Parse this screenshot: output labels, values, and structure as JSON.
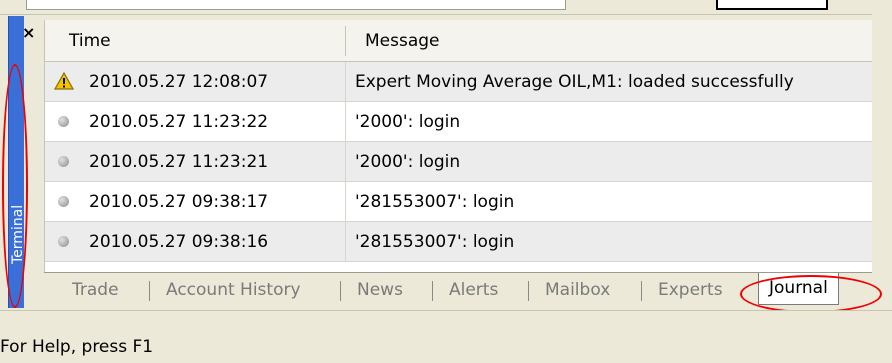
{
  "terminal": {
    "side_label": "Terminal",
    "close_symbol": "×"
  },
  "grid": {
    "columns": [
      "Time",
      "Message"
    ],
    "rows": [
      {
        "icon": "warning-icon",
        "time": "2010.05.27 12:08:07",
        "message": "Expert Moving Average OIL,M1: loaded successfully"
      },
      {
        "icon": "info-dot-icon",
        "time": "2010.05.27 11:23:22",
        "message": "'2000': login"
      },
      {
        "icon": "info-dot-icon",
        "time": "2010.05.27 11:23:21",
        "message": "'2000': login"
      },
      {
        "icon": "info-dot-icon",
        "time": "2010.05.27 09:38:17",
        "message": "'281553007': login"
      },
      {
        "icon": "info-dot-icon",
        "time": "2010.05.27 09:38:16",
        "message": "'281553007': login"
      }
    ]
  },
  "tabs": [
    {
      "label": "Trade"
    },
    {
      "label": "Account History"
    },
    {
      "label": "News"
    },
    {
      "label": "Alerts"
    },
    {
      "label": "Mailbox"
    },
    {
      "label": "Experts"
    },
    {
      "label": "Journal",
      "active": true
    }
  ],
  "status_bar": {
    "text": "For Help, press F1"
  },
  "colors": {
    "panel": "#ece9d8",
    "side_bar": "#3a6fd8",
    "highlight_ellipse": "#e00000",
    "warning": "#f2c400"
  }
}
